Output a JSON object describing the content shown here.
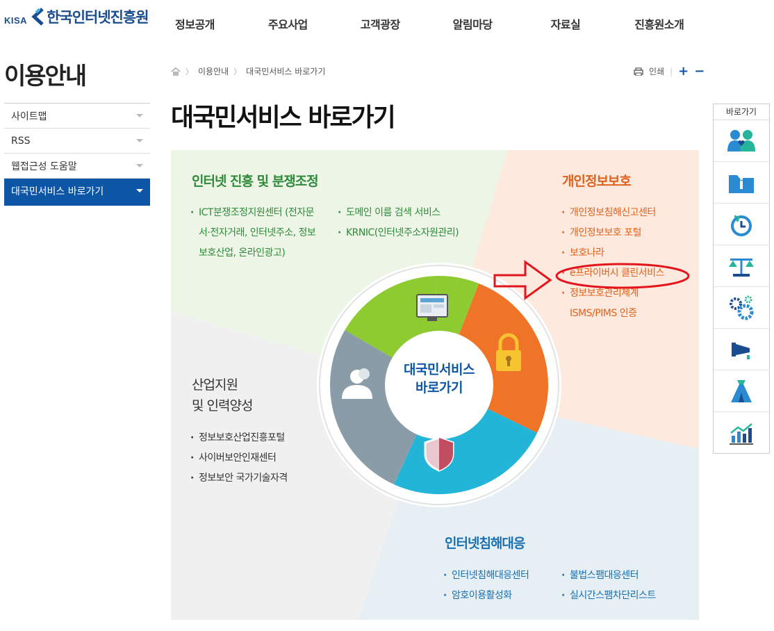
{
  "header": {
    "logo_kisa": "KISA",
    "logo_name": "한국인터넷진흥원",
    "gnb": [
      "정보공개",
      "주요사업",
      "고객광장",
      "알림마당",
      "자료실",
      "진흥원소개"
    ]
  },
  "sidebar": {
    "title": "이용안내",
    "items": [
      {
        "label": "사이트맵"
      },
      {
        "label": "RSS"
      },
      {
        "label": "웹접근성 도움말"
      },
      {
        "label": "대국민서비스 바로가기"
      }
    ]
  },
  "breadcrumb": [
    "이용안내",
    "대국민서비스 바로가기"
  ],
  "tools": {
    "print": "인쇄",
    "zoom_in": "+",
    "zoom_out": "−"
  },
  "page_title": "대국민서비스 바로가기",
  "center": {
    "line1": "대국민서비스",
    "line2": "바로가기"
  },
  "sections": {
    "internet": {
      "title": "인터넷 진흥 및 분쟁조정",
      "col1": [
        "ICT분쟁조정지원센터 (전자문",
        "서·전자거래, 인터넷주소, 정보",
        "보호산업, 온라인광고)"
      ],
      "col2": [
        "도메인 이름 검색 서비스",
        "KRNIC(인터넷주소자원관리)"
      ]
    },
    "privacy": {
      "title": "개인정보보호",
      "items": [
        "개인정보침해신고센터",
        "개인정보보호 포털",
        "보호나라",
        "e프라이버시 클린서비스",
        "정보보호관리체계",
        "ISMS/PIMS 인증"
      ]
    },
    "industry": {
      "title_line1": "산업지원",
      "title_line2": "및 인력양성",
      "items": [
        "정보보호산업진흥포털",
        "사이버보안인재센터",
        "정보보안 국가기술자격"
      ]
    },
    "response": {
      "title": "인터넷침해대응",
      "col1": [
        "인터넷침해대응센터",
        "암호이용활성화"
      ],
      "col2": [
        "불법스팸대응센터",
        "실시간스팸차단리스트"
      ]
    }
  },
  "quick": {
    "title": "바로가기",
    "icons": [
      "people-icon",
      "info-folder-icon",
      "timer-icon",
      "scale-icon",
      "gears-icon",
      "megaphone-icon",
      "money-bag-icon",
      "growth-chart-icon"
    ]
  },
  "colors": {
    "brand_blue": "#0d56a6",
    "green": "#8ecb31",
    "orange": "#f07428",
    "cyan": "#22b5d8",
    "slate": "#8a9ca8",
    "highlight_red": "#e3141b"
  }
}
